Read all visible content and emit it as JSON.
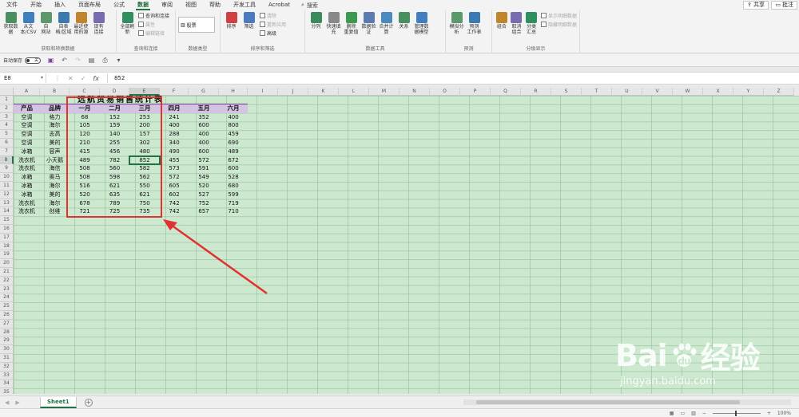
{
  "menu": {
    "items": [
      "文件",
      "开始",
      "插入",
      "页面布局",
      "公式",
      "数据",
      "审阅",
      "视图",
      "帮助",
      "开发工具",
      "Acrobat"
    ],
    "active_index": 5,
    "search": "搜索",
    "share": "共享",
    "comment": "批注"
  },
  "ribbon": {
    "groups": [
      {
        "label": "获取和转换数据",
        "buttons": [
          "获取数\n据",
          "从文\n本/CSV",
          "自\n网站",
          "自表\n格/区域",
          "最近使\n用的源",
          "现有\n连接"
        ]
      },
      {
        "label": "查询和连接",
        "buttons": [
          "全部刷新"
        ],
        "small": [
          "查询和连接",
          "属性",
          "编辑链接"
        ]
      },
      {
        "label": "数据类型",
        "datatype": "股票"
      },
      {
        "label": "排序和筛选",
        "buttons": [
          "排序",
          "筛选"
        ],
        "small": [
          "清除",
          "重新应用",
          "高级"
        ]
      },
      {
        "label": "数据工具",
        "buttons": [
          "分列",
          "快速填充",
          "删除\n重复值",
          "数据验\n证",
          "合并计算",
          "关系",
          "管理数\n据模型"
        ]
      },
      {
        "label": "预测",
        "buttons": [
          "模拟分析",
          "预测\n工作表"
        ]
      },
      {
        "label": "分级显示",
        "buttons": [
          "组合",
          "取消组合",
          "分类汇总"
        ],
        "small": [
          "显示明细数据",
          "隐藏明细数据"
        ]
      }
    ]
  },
  "qat": {
    "autosave_label": "自动保存",
    "toggle_state": "关"
  },
  "formula_bar": {
    "name_box": "E8",
    "fx": "fx",
    "value": "852"
  },
  "grid": {
    "columns": [
      "A",
      "B",
      "C",
      "D",
      "E",
      "F",
      "G",
      "H",
      "I",
      "J",
      "K",
      "L",
      "M",
      "N",
      "O",
      "P",
      "Q",
      "R",
      "S",
      "T",
      "U",
      "V",
      "W",
      "X",
      "Y",
      "Z"
    ],
    "selected_col": "E",
    "selected_row": 8,
    "title": "远航贸易销售统计表",
    "headers": [
      "产品",
      "品牌",
      "一月",
      "二月",
      "三月",
      "四月",
      "五月",
      "六月"
    ],
    "rows": [
      [
        "空调",
        "格力",
        "68",
        "152",
        "253",
        "241",
        "352",
        "400"
      ],
      [
        "空调",
        "海尔",
        "105",
        "159",
        "200",
        "400",
        "600",
        "800"
      ],
      [
        "空调",
        "志高",
        "120",
        "140",
        "157",
        "288",
        "400",
        "459"
      ],
      [
        "空调",
        "美的",
        "210",
        "255",
        "302",
        "340",
        "400",
        "690"
      ],
      [
        "冰箱",
        "容声",
        "415",
        "456",
        "480",
        "490",
        "600",
        "489"
      ],
      [
        "洗衣机",
        "小天鹅",
        "489",
        "782",
        "852",
        "455",
        "572",
        "672"
      ],
      [
        "洗衣机",
        "海信",
        "508",
        "560",
        "582",
        "573",
        "591",
        "600"
      ],
      [
        "冰箱",
        "奥马",
        "508",
        "598",
        "562",
        "572",
        "549",
        "528"
      ],
      [
        "冰箱",
        "海尔",
        "516",
        "621",
        "550",
        "605",
        "520",
        "680"
      ],
      [
        "冰箱",
        "美的",
        "520",
        "635",
        "621",
        "602",
        "527",
        "599"
      ],
      [
        "洗衣机",
        "海尔",
        "678",
        "789",
        "750",
        "742",
        "752",
        "719"
      ],
      [
        "洗衣机",
        "创维",
        "721",
        "725",
        "735",
        "742",
        "657",
        "710"
      ]
    ]
  },
  "tabs": {
    "sheet": "Sheet1",
    "add": "+"
  },
  "status": {
    "zoom": "100%"
  },
  "watermark": {
    "main": "Bai",
    "main2": "经验",
    "sub": "jingyan.baidu.com"
  },
  "colors": {
    "excel_green": "#217346",
    "sheet_bg": "#cce8cf",
    "header_band": "#d5c3e3",
    "annotation": "#e0322e"
  }
}
